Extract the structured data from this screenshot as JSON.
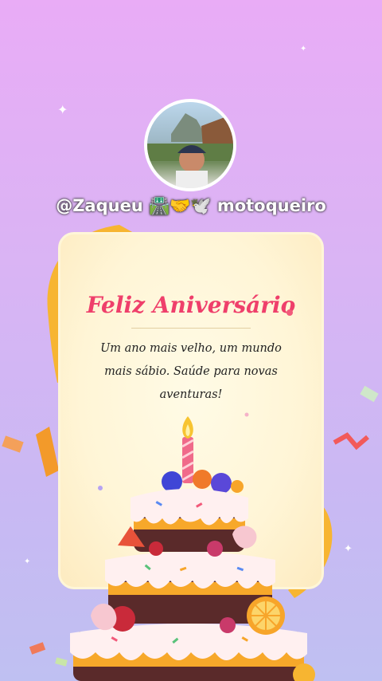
{
  "profile": {
    "username": "@Zaqueu 🛣️🤝🕊️ motoqueiro"
  },
  "card": {
    "title": "Feliz Aniversário",
    "message": "Um ano mais velho, um mundo mais sábio. Saúde para novas aventuras!"
  },
  "colors": {
    "background_top": "#e9acf6",
    "background_bottom": "#bfc0f2",
    "title": "#ef3f6b",
    "ribbon": "#f7b531"
  }
}
